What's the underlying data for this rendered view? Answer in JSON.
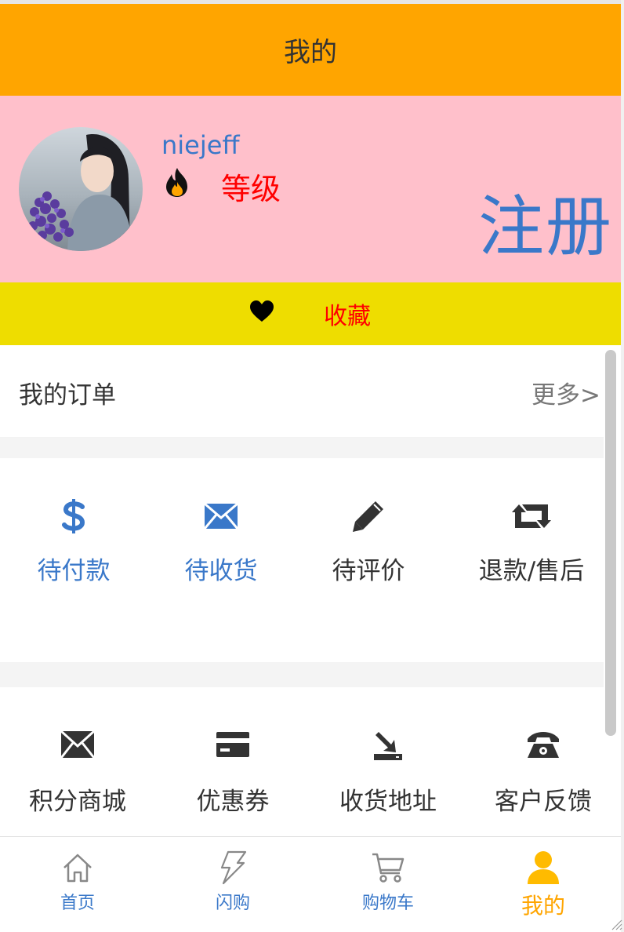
{
  "header": {
    "title": "我的"
  },
  "profile": {
    "username": "niejeff",
    "level_label": "等级",
    "register_label": "注册",
    "avatar_icon": "user-photo-avatar",
    "level_icon": "fire-icon"
  },
  "favorites": {
    "label": "收藏",
    "icon": "heart-icon"
  },
  "orders": {
    "title": "我的订单",
    "more_label": "更多>"
  },
  "order_status": [
    {
      "label": "待付款",
      "icon": "dollar-icon",
      "color": "#3a78c9"
    },
    {
      "label": "待收货",
      "icon": "envelope-icon",
      "color": "#3a78c9"
    },
    {
      "label": "待评价",
      "icon": "pencil-icon",
      "color": "#333333"
    },
    {
      "label": "退款/售后",
      "icon": "retweet-icon",
      "color": "#333333"
    }
  ],
  "services": [
    {
      "label": "积分商城",
      "icon": "envelope-icon"
    },
    {
      "label": "优惠券",
      "icon": "credit-card-icon"
    },
    {
      "label": "收货地址",
      "icon": "download-icon"
    },
    {
      "label": "客户反馈",
      "icon": "phone-icon"
    }
  ],
  "tabbar": [
    {
      "label": "首页",
      "icon": "home-icon",
      "active": false
    },
    {
      "label": "闪购",
      "icon": "lightning-icon",
      "active": false
    },
    {
      "label": "购物车",
      "icon": "cart-icon",
      "active": false
    },
    {
      "label": "我的",
      "icon": "user-icon",
      "active": true
    }
  ],
  "colors": {
    "header_bg": "#ffa500",
    "profile_bg": "#ffc0cb",
    "favorites_bg": "#eedd00",
    "accent_blue": "#3a78c9",
    "alert_red": "#ff0000",
    "active_tab": "#ffa500"
  }
}
